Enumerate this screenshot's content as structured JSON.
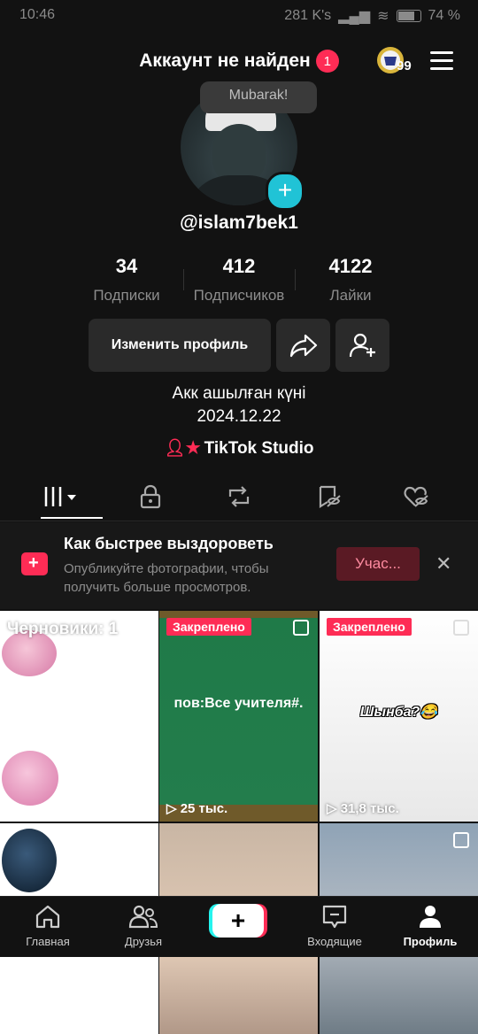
{
  "status": {
    "time": "10:46",
    "speed": "281 K's",
    "battery": "74 %"
  },
  "header": {
    "title": "Аккаунт не найден",
    "notification_count": "1",
    "badge_number": "99"
  },
  "profile": {
    "bubble": "Mubarak!",
    "username": "@islam7bek1",
    "stats": [
      {
        "value": "34",
        "label": "Подписки"
      },
      {
        "value": "412",
        "label": "Подписчиков"
      },
      {
        "value": "4122",
        "label": "Лайки"
      }
    ],
    "edit_label": "Изменить профиль",
    "bio_line1": "Акк ашылған күні",
    "bio_line2": "2024.12.22",
    "studio_label": "TikTok Studio"
  },
  "banner": {
    "title": "Как быстрее выздороветь",
    "text_line1": "Опубликуйте фотографии, чтобы",
    "text_line2": "получить больше просмотров.",
    "cta": "Учас..."
  },
  "grid": {
    "drafts": "Черновики: 1",
    "items": [
      {
        "pinned": "Закреплено",
        "caption": "пов:Все учителя#.",
        "views": "25 тыс."
      },
      {
        "pinned": "Закреплено",
        "caption": "Шынба?😂",
        "views": "31,8 тыс."
      }
    ]
  },
  "nav": {
    "home": "Главная",
    "friends": "Друзья",
    "inbox": "Входящие",
    "profile": "Профиль",
    "plus": "+"
  },
  "colors": {
    "accent": "#fe2c55",
    "cyan": "#25f4ee",
    "background": "#121212"
  }
}
